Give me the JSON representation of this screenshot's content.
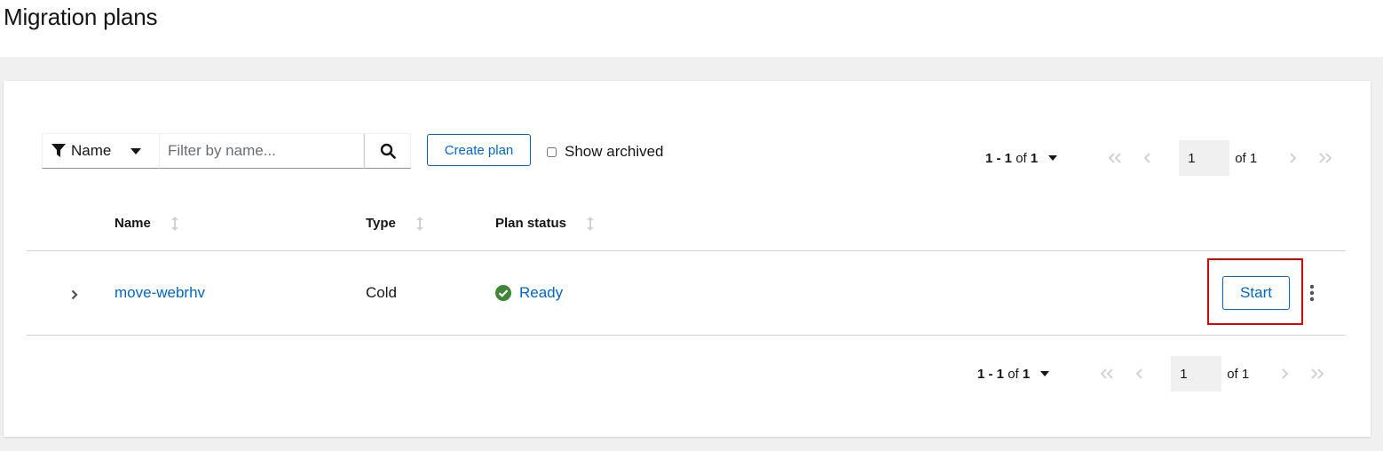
{
  "page": {
    "title": "Migration plans"
  },
  "toolbar": {
    "filter_label": "Name",
    "search_placeholder": "Filter by name...",
    "search_value": "",
    "create_label": "Create plan",
    "archived_label": "Show archived",
    "archived_checked": false
  },
  "pagination": {
    "range_start": "1 - 1",
    "range_sep": "of",
    "range_total": "1",
    "current_page": "1",
    "of_label": "of 1"
  },
  "table": {
    "columns": [
      "Name",
      "Type",
      "Plan status"
    ],
    "rows": [
      {
        "name": "move-webrhv",
        "type": "Cold",
        "status": "Ready",
        "action": "Start"
      }
    ]
  },
  "colors": {
    "link": "#0066cc",
    "success": "#3e8635",
    "highlight": "#e00000"
  },
  "icons": [
    "filter-icon",
    "caret-down-icon",
    "search-icon",
    "angle-double-left-icon",
    "angle-left-icon",
    "angle-right-icon",
    "angle-double-right-icon",
    "sort-icon",
    "angle-right-expand-icon",
    "check-circle-icon",
    "kebab-icon"
  ]
}
